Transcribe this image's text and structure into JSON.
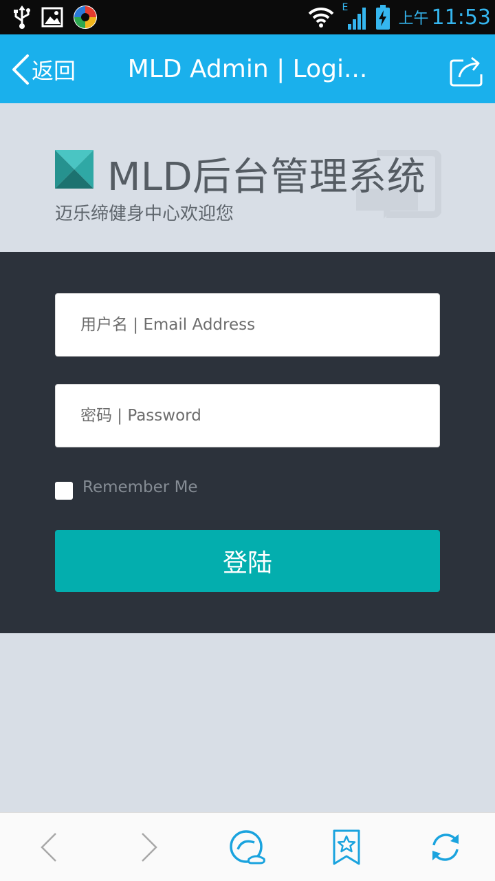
{
  "status_bar": {
    "ampm": "上午",
    "time": "11:53",
    "network_label": "E",
    "icons": [
      "usb-icon",
      "gallery-icon",
      "app-icon",
      "wifi-icon",
      "signal-icon",
      "battery-icon"
    ],
    "time_color": "#35b6ef"
  },
  "navbar": {
    "back_label": "返回",
    "title": "MLD Admin | Logi...",
    "background": "#1ab0ec",
    "share_icon": "share-icon"
  },
  "hero": {
    "brand": "MLD后台管理系统",
    "tagline": "迈乐缔健身中心欢迎您"
  },
  "login_form": {
    "username_placeholder": "用户名 | Email Address",
    "password_placeholder": "密码 | Password",
    "remember_label": "Remember Me",
    "remember_checked": false,
    "submit_label": "登陆",
    "button_color": "#03aeae",
    "panel_color": "#2c323b"
  },
  "toolbar": {
    "icons": [
      "back-arrow-icon",
      "forward-arrow-icon",
      "browser-logo-icon",
      "bookmark-star-icon",
      "refresh-icon"
    ],
    "icon_color": "#1aa3de"
  }
}
